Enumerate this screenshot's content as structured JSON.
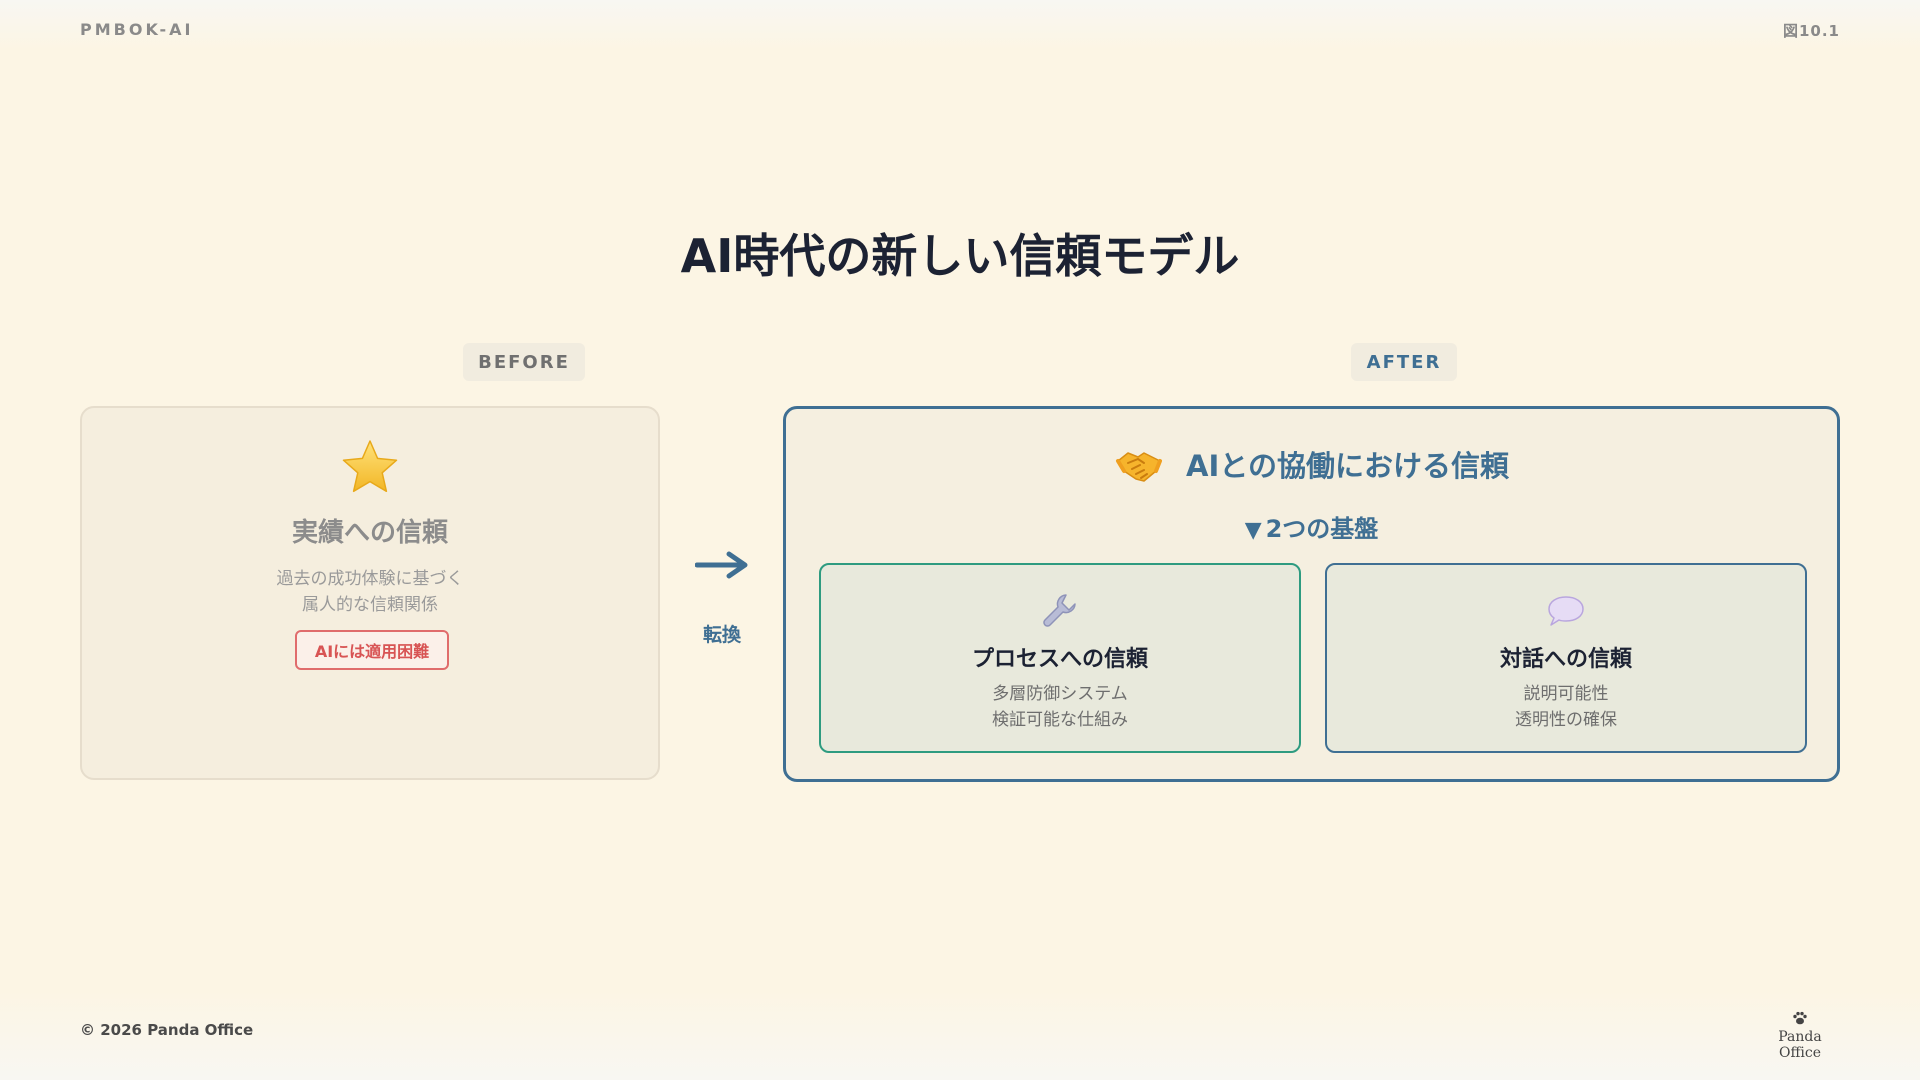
{
  "header": {
    "brand": "PMBOK-AI",
    "figure_number": "図10.1"
  },
  "title": "AI時代の新しい信頼モデル",
  "before": {
    "tag": "BEFORE",
    "icon": "star-icon",
    "title": "実績への信頼",
    "description_lines": [
      "過去の成功体験に基づく",
      "属人的な信頼関係"
    ],
    "badge": "AIには適用困難",
    "badge_color": "#e06c6c"
  },
  "transition": {
    "icon": "right-arrow-icon",
    "label": "転換"
  },
  "after": {
    "tag": "AFTER",
    "icon": "handshake-icon",
    "title": "AIとの協働における信頼",
    "subheading_marker": "▼",
    "subheading": "2つの基盤",
    "accent_color": "#3f6f93",
    "pillars": [
      {
        "icon": "wrench-icon",
        "title": "プロセスへの信頼",
        "description_lines": [
          "多層防御システム",
          "検証可能な仕組み"
        ],
        "border_color": "#2e9b80"
      },
      {
        "icon": "speech-bubble-icon",
        "title": "対話への信頼",
        "description_lines": [
          "説明可能性",
          "透明性の確保"
        ],
        "border_color": "#3f6f93"
      }
    ]
  },
  "footer": {
    "copyright": "© 2026 Panda Office",
    "logo_text": "Panda Office",
    "logo_icon": "paw-icon"
  }
}
